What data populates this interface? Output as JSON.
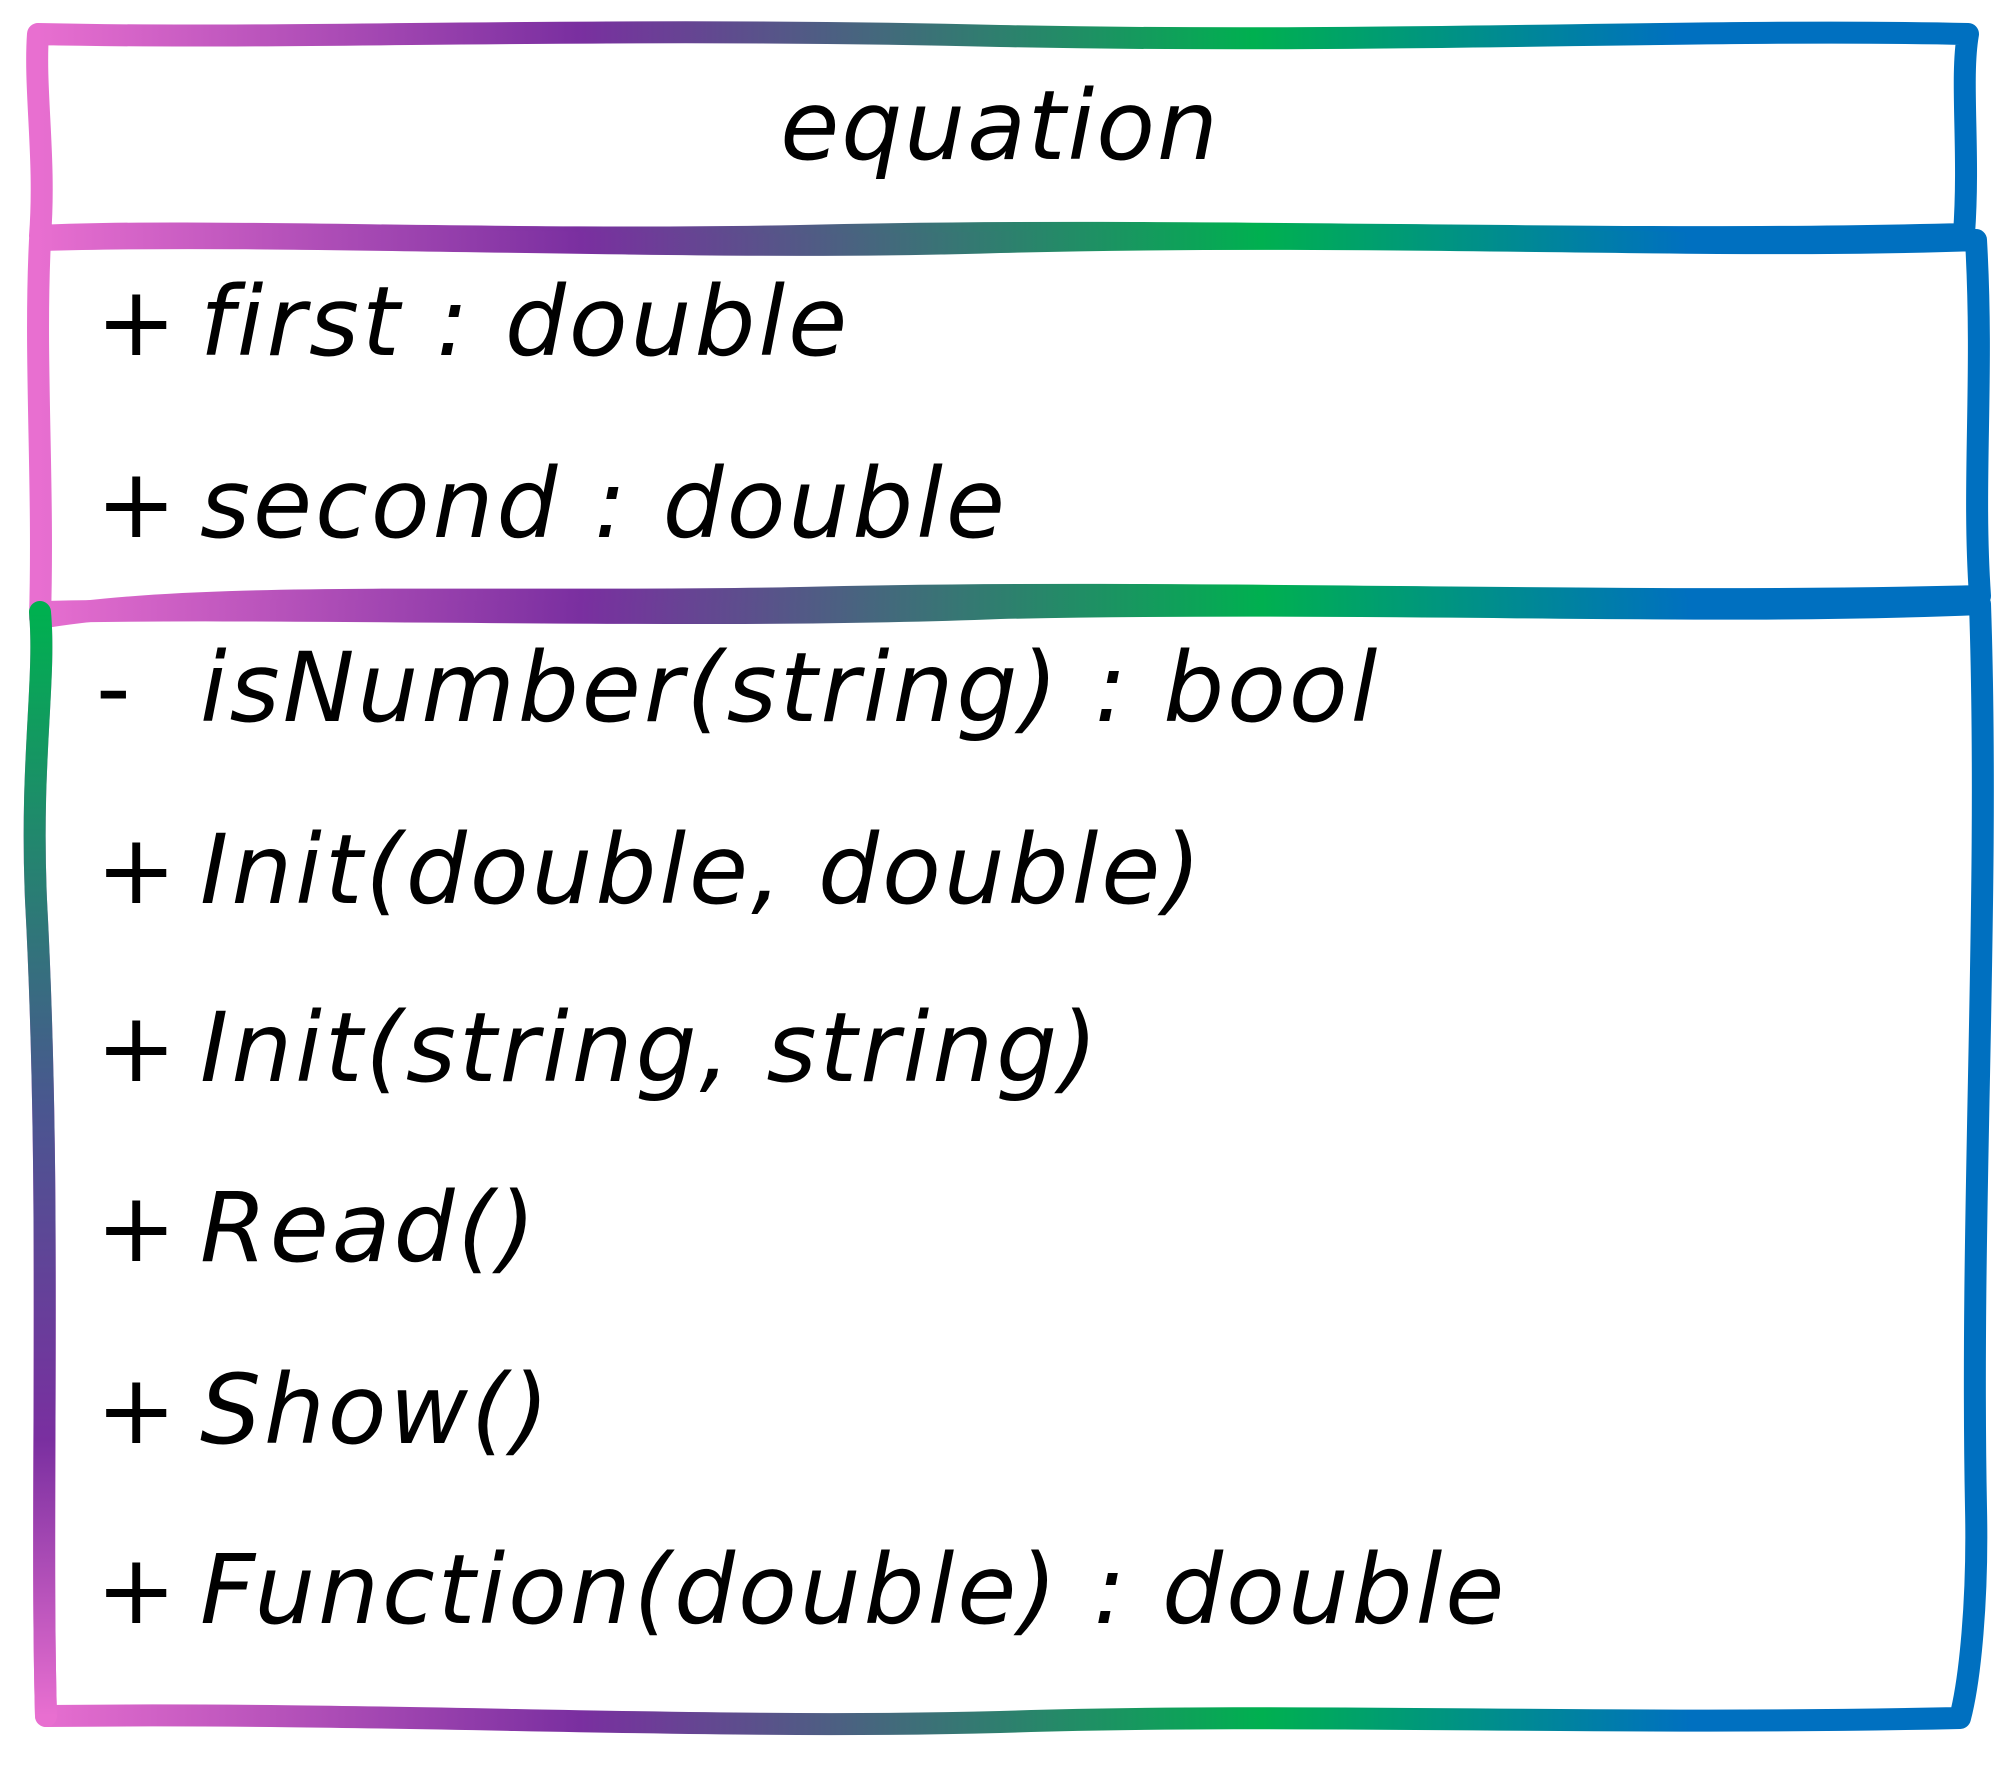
{
  "uml_class": {
    "name": "equation",
    "attributes": [
      {
        "visibility": "+",
        "text": "first : double"
      },
      {
        "visibility": "+",
        "text": "second : double"
      }
    ],
    "operations": [
      {
        "visibility": "-",
        "text": "isNumber(string) : bool"
      },
      {
        "visibility": "+",
        "text": "Init(double, double)"
      },
      {
        "visibility": "+",
        "text": "Init(string, string)"
      },
      {
        "visibility": "+",
        "text": "Read()"
      },
      {
        "visibility": "+",
        "text": "Show()"
      },
      {
        "visibility": "+",
        "text": "Function(double) : double"
      }
    ]
  },
  "colors": {
    "gradient": [
      "#e86fd0",
      "#7a2fa0",
      "#00b050",
      "#0070c0"
    ],
    "text": "#000000",
    "background": "#ffffff"
  }
}
